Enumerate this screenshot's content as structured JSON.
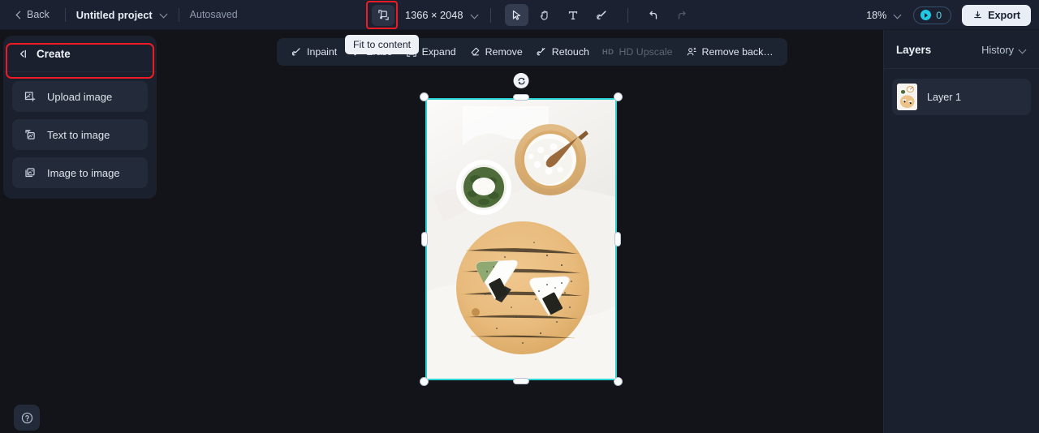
{
  "header": {
    "back_label": "Back",
    "project_name": "Untitled project",
    "autosaved_label": "Autosaved",
    "canvas_dimensions": "1366 × 2048",
    "zoom_level": "18%",
    "credits_count": "0",
    "export_label": "Export",
    "fit_icon": "fit-to-content-icon",
    "tools": [
      {
        "name": "select-tool",
        "icon": "cursor-icon",
        "active": true
      },
      {
        "name": "pan-tool",
        "icon": "hand-icon",
        "active": false
      },
      {
        "name": "text-tool",
        "icon": "text-t-icon",
        "active": false
      },
      {
        "name": "brush-tool",
        "icon": "brush-icon",
        "active": false
      }
    ],
    "undo_label": "undo-icon",
    "redo_label": "redo-icon"
  },
  "sidebar": {
    "title": "Create",
    "collapse_icon": "collapse-panel-icon",
    "items": [
      {
        "label": "Upload image",
        "icon": "upload-image-icon",
        "highlighted": true
      },
      {
        "label": "Text to image",
        "icon": "text-to-image-icon",
        "highlighted": false
      },
      {
        "label": "Image to image",
        "icon": "image-to-image-icon",
        "highlighted": false
      }
    ],
    "help_icon": "help-question-icon"
  },
  "canvas_toolbar": {
    "items": [
      {
        "label": "Inpaint",
        "icon": "inpaint-icon",
        "disabled": false
      },
      {
        "label": "Erase",
        "icon": "erase-icon",
        "disabled": false
      },
      {
        "label": "Expand",
        "icon": "expand-icon",
        "disabled": false
      },
      {
        "label": "Remove",
        "icon": "remove-icon",
        "disabled": false
      },
      {
        "label": "Retouch",
        "icon": "retouch-icon",
        "disabled": false
      },
      {
        "label": "HD Upscale",
        "icon": "hd-upscale-icon",
        "disabled": true
      },
      {
        "label": "Remove back…",
        "icon": "remove-background-icon",
        "disabled": false
      }
    ],
    "tooltip": "Fit to content"
  },
  "right_panel": {
    "title": "Layers",
    "history_label": "History",
    "layers": [
      {
        "name": "Layer 1",
        "thumbnail": "food-photo-thumbnail"
      }
    ]
  },
  "selection": {
    "rotate_icon": "rotate-handle-icon",
    "border_color": "#2ad3d3"
  },
  "colors": {
    "header_bg": "#1b2130",
    "panel_bg": "#1a202d",
    "canvas_bg": "#121419",
    "accent_cyan": "#2ad3d3",
    "annotation_red": "#ee1b24",
    "credits_cyan": "#5fd8ea"
  }
}
